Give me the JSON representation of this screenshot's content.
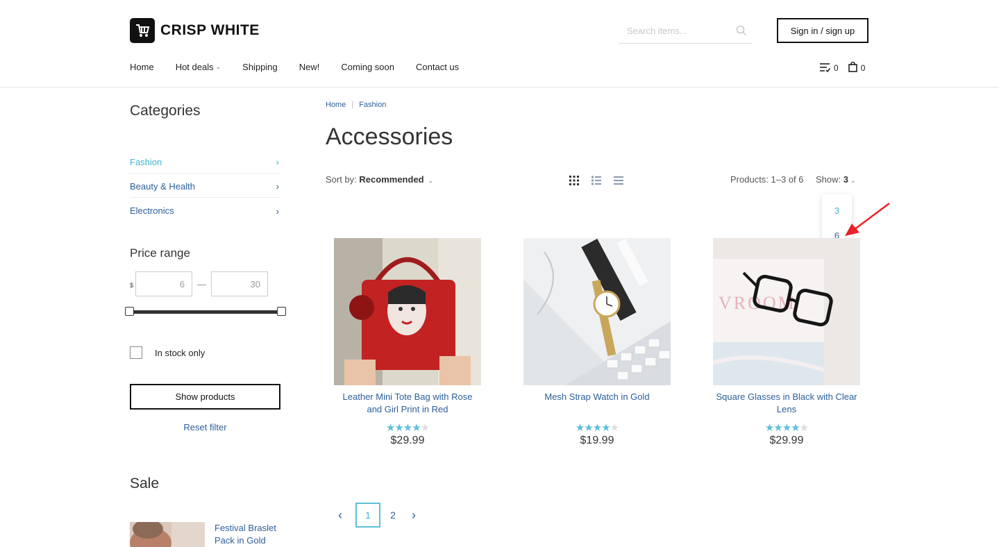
{
  "brand": {
    "name": "CRISP WHITE"
  },
  "search": {
    "placeholder": "Search items..."
  },
  "auth": {
    "label": "Sign in / sign up"
  },
  "nav": {
    "items": [
      {
        "label": "Home"
      },
      {
        "label": "Hot deals"
      },
      {
        "label": "Shipping"
      },
      {
        "label": "New!"
      },
      {
        "label": "Coming soon"
      },
      {
        "label": "Contact us"
      }
    ]
  },
  "header": {
    "compare_count": "0",
    "cart_count": "0"
  },
  "sidebar": {
    "categories_title": "Categories",
    "categories": [
      {
        "label": "Fashion"
      },
      {
        "label": "Beauty & Health"
      },
      {
        "label": "Electronics"
      }
    ],
    "price_title": "Price range",
    "currency": "$",
    "price_min": "6",
    "price_max": "30",
    "in_stock_label": "In stock only",
    "show_products_label": "Show products",
    "reset_label": "Reset filter",
    "sale_title": "Sale",
    "sale_item_name": "Festival Braslet Pack in Gold"
  },
  "main": {
    "breadcrumb": [
      "Home",
      "Fashion"
    ],
    "title": "Accessories",
    "sort_label": "Sort by:",
    "sort_value": "Recommended",
    "products_count": "Products: 1–3 of 6",
    "show_label": "Show:",
    "show_value": "3",
    "show_options": [
      "3",
      "6"
    ]
  },
  "products": [
    {
      "name": "Leather Mini Tote Bag with Rose and Girl Print in Red",
      "price": "$29.99",
      "rating": 4
    },
    {
      "name": "Mesh Strap Watch in Gold",
      "price": "$19.99",
      "rating": 4
    },
    {
      "name": "Square Glasses in Black with Clear Lens",
      "price": "$29.99",
      "rating": 4
    }
  ],
  "pagination": {
    "pages": [
      "1",
      "2"
    ],
    "current": "1"
  },
  "colors": {
    "accent": "#5bc0d8",
    "link": "#2b5e99",
    "annotation": "#e8222a"
  }
}
